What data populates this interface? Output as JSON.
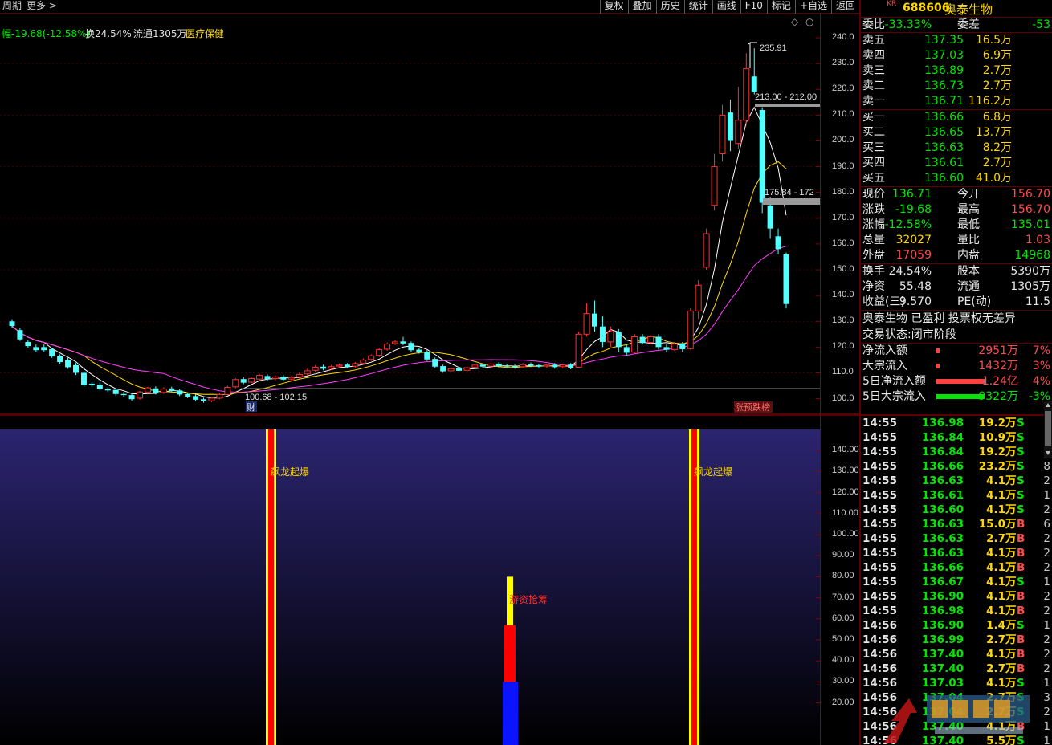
{
  "toolbar": {
    "left": [
      "周期",
      "更多 >"
    ],
    "right": [
      "复权",
      "叠加",
      "历史",
      "统计",
      "画线",
      "F10",
      "标记",
      "+自选",
      "返回"
    ]
  },
  "info_line": {
    "change": "幅-19.68(-12.58%)",
    "turnover": "换24.54%",
    "float": "流通1305万",
    "sector": "医疗保健"
  },
  "main_chart": {
    "y_ticks": [
      "240.0",
      "230.0",
      "220.0",
      "210.0",
      "200.0",
      "190.0",
      "180.0",
      "170.0",
      "160.0",
      "150.0",
      "140.0",
      "130.0",
      "120.0",
      "110.0",
      "100.0"
    ],
    "annot_high": "235.91",
    "annot_gap1": "213.00 - 212.00",
    "annot_gap2": "175.84 - 172",
    "annot_low": "100.68 - 102.15",
    "badge_cai": "财",
    "badge_zt": "涨预跌榜"
  },
  "chart_data": {
    "type": "candlestick",
    "ylim": [
      98,
      245
    ],
    "candles": [
      [
        130.0,
        128.2,
        130.8,
        127.6
      ],
      [
        126.6,
        123.0,
        127.3,
        122.4
      ],
      [
        122.0,
        120.4,
        122.6,
        119.8
      ],
      [
        120.0,
        118.8,
        121.0,
        118.2
      ],
      [
        120.0,
        118.8,
        121.0,
        118.2
      ],
      [
        119.2,
        116.4,
        119.8,
        115.8
      ],
      [
        116.6,
        114.2,
        117.2,
        113.4
      ],
      [
        115.0,
        112.2,
        115.8,
        111.6
      ],
      [
        113.0,
        110.0,
        113.8,
        109.2
      ],
      [
        110.0,
        105.2,
        110.6,
        104.6
      ],
      [
        105.8,
        105.2,
        106.4,
        104.6
      ],
      [
        105.4,
        103.8,
        106.2,
        103.2
      ],
      [
        103.8,
        103.2,
        104.4,
        102.6
      ],
      [
        103.4,
        101.8,
        104.0,
        101.2
      ],
      [
        101.8,
        101.4,
        102.6,
        100.8
      ],
      [
        101.4,
        99.8,
        102.0,
        99.2
      ],
      [
        100.2,
        102.6,
        103.0,
        99.6
      ],
      [
        102.6,
        104.2,
        104.6,
        102.0
      ],
      [
        104.0,
        102.2,
        104.8,
        101.6
      ],
      [
        102.4,
        103.8,
        104.4,
        101.8
      ],
      [
        104.0,
        103.0,
        104.6,
        102.4
      ],
      [
        103.2,
        101.6,
        103.8,
        101.0
      ],
      [
        101.8,
        100.8,
        102.4,
        100.2
      ],
      [
        101.0,
        99.6,
        101.6,
        99.0
      ],
      [
        99.8,
        99.0,
        100.4,
        98.4
      ],
      [
        99.2,
        100.2,
        100.8,
        98.6
      ],
      [
        100.2,
        101.6,
        102.2,
        99.8
      ],
      [
        101.6,
        104.4,
        105.0,
        101.2
      ],
      [
        104.6,
        107.4,
        108.0,
        104.0
      ],
      [
        107.6,
        106.2,
        108.4,
        105.6
      ],
      [
        106.4,
        107.8,
        108.4,
        106.0
      ],
      [
        107.6,
        109.0,
        109.6,
        107.2
      ],
      [
        108.8,
        107.6,
        109.4,
        107.0
      ],
      [
        107.8,
        108.4,
        109.0,
        107.2
      ],
      [
        108.6,
        107.4,
        109.2,
        106.8
      ],
      [
        107.6,
        108.2,
        108.8,
        107.0
      ],
      [
        108.4,
        109.4,
        110.0,
        107.8
      ],
      [
        109.6,
        110.8,
        111.6,
        109.0
      ],
      [
        111.0,
        112.2,
        113.0,
        110.4
      ],
      [
        112.4,
        111.6,
        113.2,
        111.0
      ],
      [
        111.8,
        112.4,
        113.0,
        111.2
      ],
      [
        112.6,
        113.0,
        113.6,
        112.0
      ],
      [
        113.2,
        112.4,
        113.8,
        111.8
      ],
      [
        112.6,
        113.6,
        114.2,
        112.0
      ],
      [
        113.8,
        115.0,
        115.6,
        113.2
      ],
      [
        115.2,
        116.6,
        117.2,
        114.6
      ],
      [
        116.8,
        119.0,
        119.6,
        116.2
      ],
      [
        119.2,
        121.2,
        121.8,
        118.6
      ],
      [
        121.4,
        122.0,
        122.6,
        120.8
      ],
      [
        122.2,
        121.4,
        124.0,
        120.8
      ],
      [
        121.6,
        118.8,
        122.2,
        118.2
      ],
      [
        119.0,
        118.0,
        119.6,
        117.4
      ],
      [
        118.2,
        115.2,
        118.8,
        114.6
      ],
      [
        115.4,
        112.4,
        116.0,
        111.8
      ],
      [
        112.6,
        110.6,
        113.2,
        110.0
      ],
      [
        110.8,
        111.6,
        112.2,
        110.2
      ],
      [
        111.8,
        110.8,
        112.4,
        110.2
      ],
      [
        111.0,
        112.0,
        112.6,
        110.4
      ],
      [
        112.2,
        113.0,
        113.6,
        111.6
      ],
      [
        113.2,
        112.4,
        113.8,
        111.8
      ],
      [
        112.6,
        113.4,
        114.0,
        112.0
      ],
      [
        113.6,
        112.6,
        114.2,
        112.0
      ],
      [
        112.8,
        112.4,
        113.4,
        111.8
      ],
      [
        112.6,
        112.2,
        113.2,
        111.6
      ],
      [
        112.4,
        113.2,
        113.8,
        111.8
      ],
      [
        113.4,
        112.8,
        114.0,
        112.2
      ],
      [
        113.0,
        112.4,
        113.6,
        111.8
      ],
      [
        112.6,
        113.0,
        113.6,
        112.0
      ],
      [
        113.2,
        112.2,
        113.8,
        111.6
      ],
      [
        112.4,
        113.0,
        113.6,
        111.8
      ],
      [
        113.2,
        112.0,
        113.8,
        111.4
      ],
      [
        112.2,
        125.0,
        126.0,
        112.0
      ],
      [
        125.0,
        133.0,
        137.0,
        124.0
      ],
      [
        133.0,
        128.0,
        138.0,
        126.0
      ],
      [
        128.0,
        122.0,
        132.0,
        120.0
      ],
      [
        122.0,
        126.0,
        128.0,
        120.0
      ],
      [
        126.0,
        120.0,
        127.0,
        118.0
      ],
      [
        120.0,
        117.8,
        121.0,
        116.8
      ],
      [
        118.0,
        124.0,
        125.0,
        117.6
      ],
      [
        124.0,
        121.6,
        125.0,
        121.0
      ],
      [
        121.8,
        124.0,
        124.6,
        121.0
      ],
      [
        124.0,
        120.0,
        125.0,
        119.0
      ],
      [
        120.0,
        119.0,
        121.0,
        118.0
      ],
      [
        119.0,
        121.2,
        122.0,
        118.6
      ],
      [
        121.4,
        119.2,
        122.0,
        118.0
      ],
      [
        119.4,
        134.0,
        135.0,
        119.0
      ],
      [
        134.0,
        144.0,
        146.0,
        131.0
      ],
      [
        151.0,
        164.0,
        166.0,
        150.0
      ],
      [
        175.0,
        190.0,
        195.0,
        173.0
      ],
      [
        195.0,
        210.0,
        214.0,
        192.0
      ],
      [
        211.0,
        200.0,
        216.0,
        196.0
      ],
      [
        199.0,
        208.0,
        221.0,
        197.0
      ],
      [
        208.0,
        228.0,
        234.0,
        206.0
      ],
      [
        225.0,
        219.0,
        235.9,
        218.0
      ],
      [
        212.0,
        176.0,
        213.0,
        172.0
      ],
      [
        175.0,
        166.0,
        178.0,
        162.0
      ],
      [
        163.0,
        158.0,
        166.0,
        156.0
      ],
      [
        156.0,
        136.7,
        156.7,
        135.0
      ]
    ]
  },
  "indicator": {
    "y_ticks": [
      "140.00",
      "130.00",
      "120.00",
      "110.00",
      "100.00",
      "90.00",
      "80.00",
      "70.00",
      "60.00",
      "50.00",
      "40.00",
      "30.00",
      "20.00"
    ],
    "label1": "飙龙起爆",
    "label2": "飙龙起爆",
    "label3": "游资抢筹",
    "bar_values": {
      "blue_top": 30,
      "red_top": 57,
      "yellow_top": 80
    }
  },
  "panel": {
    "kr": "KR",
    "code": "688606",
    "name": "奥泰生物",
    "weibi": {
      "label": "委比",
      "value": "-33.33%",
      "label2": "委差",
      "value2": "-53"
    },
    "asks": [
      {
        "label": "卖五",
        "price": "137.35",
        "vol": "16.5万"
      },
      {
        "label": "卖四",
        "price": "137.03",
        "vol": "6.9万"
      },
      {
        "label": "卖三",
        "price": "136.89",
        "vol": "2.7万"
      },
      {
        "label": "卖二",
        "price": "136.73",
        "vol": "2.7万"
      },
      {
        "label": "卖一",
        "price": "136.71",
        "vol": "116.2万"
      }
    ],
    "bids": [
      {
        "label": "买一",
        "price": "136.66",
        "vol": "6.8万"
      },
      {
        "label": "买二",
        "price": "136.65",
        "vol": "13.7万"
      },
      {
        "label": "买三",
        "price": "136.63",
        "vol": "8.2万"
      },
      {
        "label": "买四",
        "price": "136.61",
        "vol": "2.7万"
      },
      {
        "label": "买五",
        "price": "136.60",
        "vol": "41.0万"
      }
    ],
    "stats1": [
      {
        "l1": "现价",
        "v1": "136.71",
        "c1": "g",
        "l2": "今开",
        "v2": "156.70",
        "c2": "r"
      },
      {
        "l1": "涨跌",
        "v1": "-19.68",
        "c1": "g",
        "l2": "最高",
        "v2": "156.70",
        "c2": "r"
      },
      {
        "l1": "涨幅",
        "v1": "-12.58%",
        "c1": "g",
        "l2": "最低",
        "v2": "135.01",
        "c2": "g"
      },
      {
        "l1": "总量",
        "v1": "32027",
        "c1": "y",
        "l2": "量比",
        "v2": "1.03",
        "c2": "r"
      },
      {
        "l1": "外盘",
        "v1": "17059",
        "c1": "r",
        "l2": "内盘",
        "v2": "14968",
        "c2": "g"
      }
    ],
    "stats2": [
      {
        "l1": "换手",
        "v1": "24.54%",
        "c1": "w",
        "l2": "股本",
        "v2": "5390万",
        "c2": "w"
      },
      {
        "l1": "净资",
        "v1": "55.48",
        "c1": "w",
        "l2": "流通",
        "v2": "1305万",
        "c2": "w"
      },
      {
        "l1": "收益(三)",
        "v1": "9.570",
        "c1": "w",
        "l2": "PE(动)",
        "v2": "11.5",
        "c2": "w"
      }
    ],
    "status1": "奥泰生物 已盈利 投票权无差异",
    "status2": "交易状态:闭市阶段",
    "flows": [
      {
        "label": "净流入额",
        "amt": "2951万",
        "pct": "7%",
        "color": "r",
        "fill": 0.07,
        "barColor": "#ff4040"
      },
      {
        "label": "大宗流入",
        "amt": "1432万",
        "pct": "3%",
        "color": "r",
        "fill": 0.03,
        "barColor": "#ff4040"
      },
      {
        "label": "5日净流入额",
        "amt": "1.24亿",
        "pct": "4%",
        "color": "r",
        "fill": 1.0,
        "barColor": "#ff4040"
      },
      {
        "label": "5日大宗流入",
        "amt": "-9322万",
        "pct": "-3%",
        "color": "g",
        "fill": 1.0,
        "barColor": "#00e600"
      }
    ],
    "ticks": [
      {
        "t": "14:55",
        "p": "136.98",
        "v": "19.2",
        "s": "S",
        "n": "3"
      },
      {
        "t": "14:55",
        "p": "136.84",
        "v": "10.9",
        "s": "S",
        "n": ""
      },
      {
        "t": "14:55",
        "p": "136.84",
        "v": "19.2",
        "s": "S",
        "n": "7"
      },
      {
        "t": "14:55",
        "p": "136.66",
        "v": "23.2",
        "s": "S",
        "n": "8"
      },
      {
        "t": "14:55",
        "p": "136.63",
        "v": "4.1",
        "s": "S",
        "n": "2"
      },
      {
        "t": "14:55",
        "p": "136.61",
        "v": "4.1",
        "s": "S",
        "n": "1"
      },
      {
        "t": "14:55",
        "p": "136.60",
        "v": "4.1",
        "s": "S",
        "n": "2"
      },
      {
        "t": "14:55",
        "p": "136.63",
        "v": "15.0",
        "s": "B",
        "n": "6"
      },
      {
        "t": "14:55",
        "p": "136.63",
        "v": "2.7",
        "s": "B",
        "n": "2"
      },
      {
        "t": "14:55",
        "p": "136.63",
        "v": "4.1",
        "s": "B",
        "n": "2"
      },
      {
        "t": "14:55",
        "p": "136.66",
        "v": "4.1",
        "s": "B",
        "n": "2"
      },
      {
        "t": "14:55",
        "p": "136.67",
        "v": "4.1",
        "s": "S",
        "n": "1"
      },
      {
        "t": "14:55",
        "p": "136.90",
        "v": "4.1",
        "s": "B",
        "n": "2"
      },
      {
        "t": "14:55",
        "p": "136.98",
        "v": "4.1",
        "s": "B",
        "n": "2"
      },
      {
        "t": "14:56",
        "p": "136.90",
        "v": "1.4",
        "s": "S",
        "n": "1"
      },
      {
        "t": "14:56",
        "p": "136.99",
        "v": "2.7",
        "s": "B",
        "n": "2"
      },
      {
        "t": "14:56",
        "p": "137.40",
        "v": "4.1",
        "s": "B",
        "n": "2"
      },
      {
        "t": "14:56",
        "p": "137.40",
        "v": "2.7",
        "s": "B",
        "n": "2"
      },
      {
        "t": "14:56",
        "p": "137.03",
        "v": "4.1",
        "s": "S",
        "n": "1"
      },
      {
        "t": "14:56",
        "p": "137.04",
        "v": "2.7",
        "s": "S",
        "n": "3"
      },
      {
        "t": "14:56",
        "p": "137.04",
        "v": "2.7",
        "s": "S",
        "n": "2"
      },
      {
        "t": "14:56",
        "p": "137.40",
        "v": "4.1",
        "s": "B",
        "n": "1"
      },
      {
        "t": "14:56",
        "p": "137.40",
        "v": "5.5",
        "s": "S",
        "n": "1"
      }
    ]
  }
}
